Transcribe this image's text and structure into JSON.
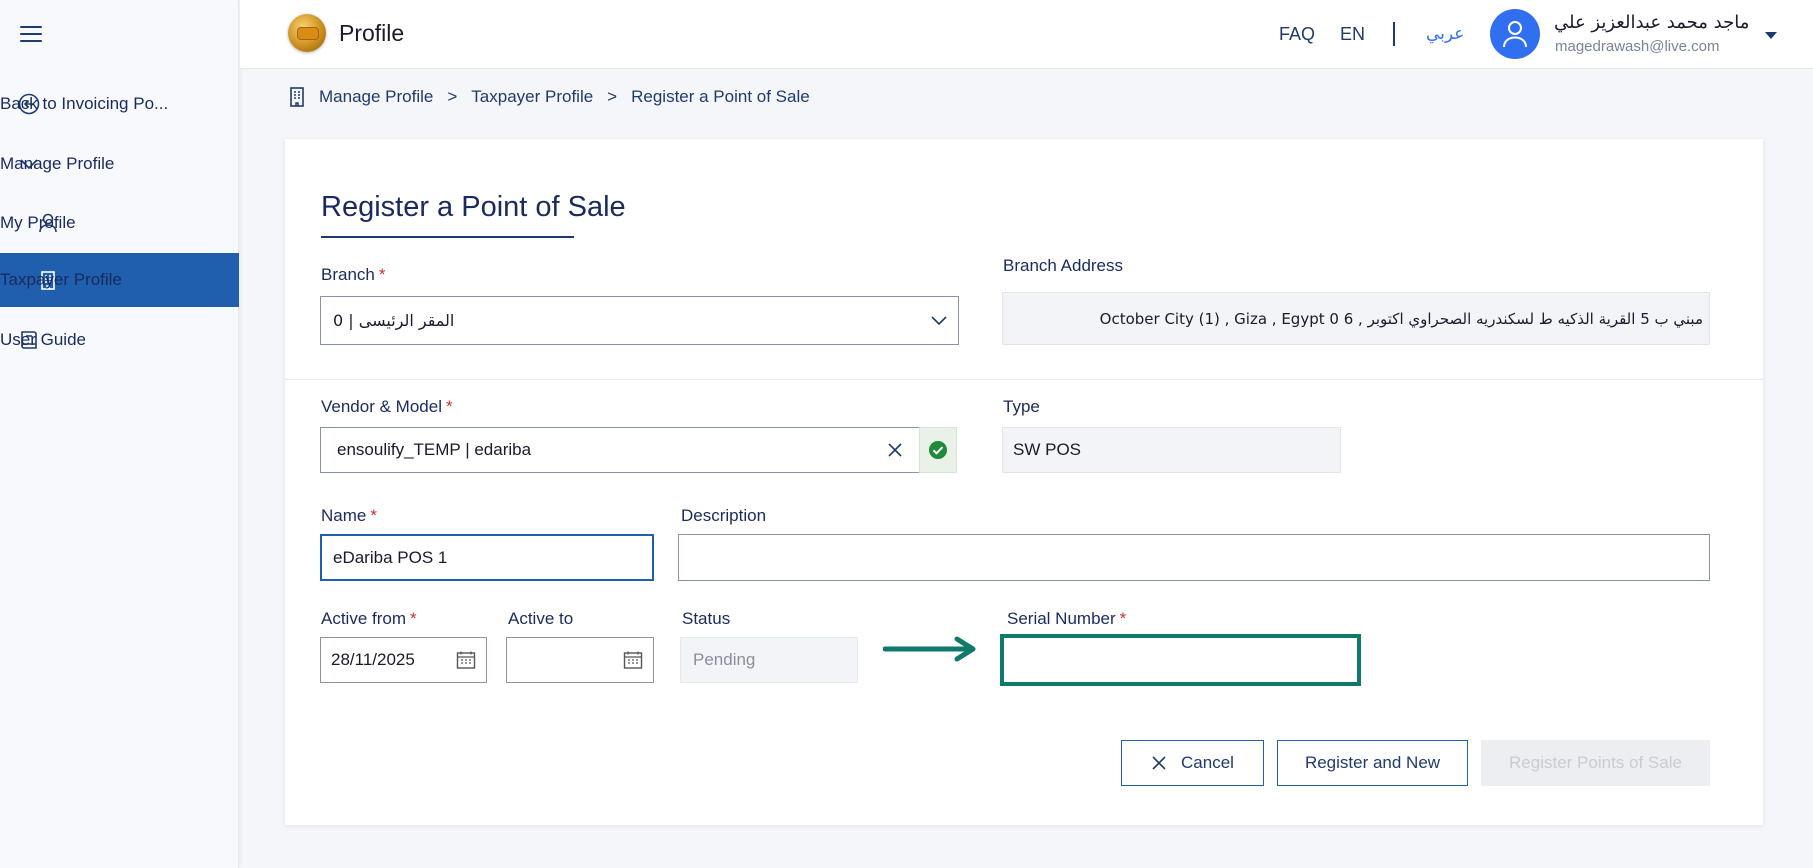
{
  "app": {
    "title": "Profile"
  },
  "header": {
    "faq": "FAQ",
    "en": "EN",
    "arabic": "عربي",
    "user_name": "ماجد محمد عبدالعزيز علي",
    "user_email": "magedrawash@live.com"
  },
  "sidebar": {
    "items": [
      {
        "label": "Back to Invoicing Po...",
        "icon": "back-circle-icon"
      },
      {
        "label": "Manage Profile",
        "icon": "chevron-down-icon"
      },
      {
        "label": "My Profile",
        "icon": "person-icon"
      },
      {
        "label": "Taxpayer Profile",
        "icon": "building-icon"
      },
      {
        "label": "User Guide",
        "icon": "book-icon"
      }
    ]
  },
  "breadcrumb": {
    "items": [
      "Manage Profile",
      "Taxpayer Profile",
      "Register a Point of Sale"
    ]
  },
  "form": {
    "title": "Register a Point of Sale",
    "branch": {
      "label": "Branch",
      "value": "المقر الرئيسى | 0"
    },
    "branch_address": {
      "label": "Branch Address",
      "value": "مبني ب 5 القرية الذكيه ط لسكندريه الصحراوي اكتوبر , 6 0 October City (1) , Giza , Egypt"
    },
    "vendor_model": {
      "label": "Vendor & Model",
      "value": "ensoulify_TEMP | edariba"
    },
    "type": {
      "label": "Type",
      "value": "SW POS"
    },
    "name": {
      "label": "Name",
      "value": "eDariba POS 1"
    },
    "description": {
      "label": "Description",
      "value": ""
    },
    "active_from": {
      "label": "Active from",
      "value": "28/11/2025"
    },
    "active_to": {
      "label": "Active to",
      "value": ""
    },
    "status": {
      "label": "Status",
      "value": "Pending"
    },
    "serial_number": {
      "label": "Serial Number",
      "value": ""
    },
    "required_mark": "*"
  },
  "buttons": {
    "cancel": "Cancel",
    "register_new": "Register and New",
    "register": "Register Points of Sale"
  },
  "colors": {
    "primary": "#1f5fae",
    "navy": "#1f3a6e",
    "highlight": "#0f7a6c",
    "success": "#1e8a3a",
    "required": "#d03030"
  }
}
